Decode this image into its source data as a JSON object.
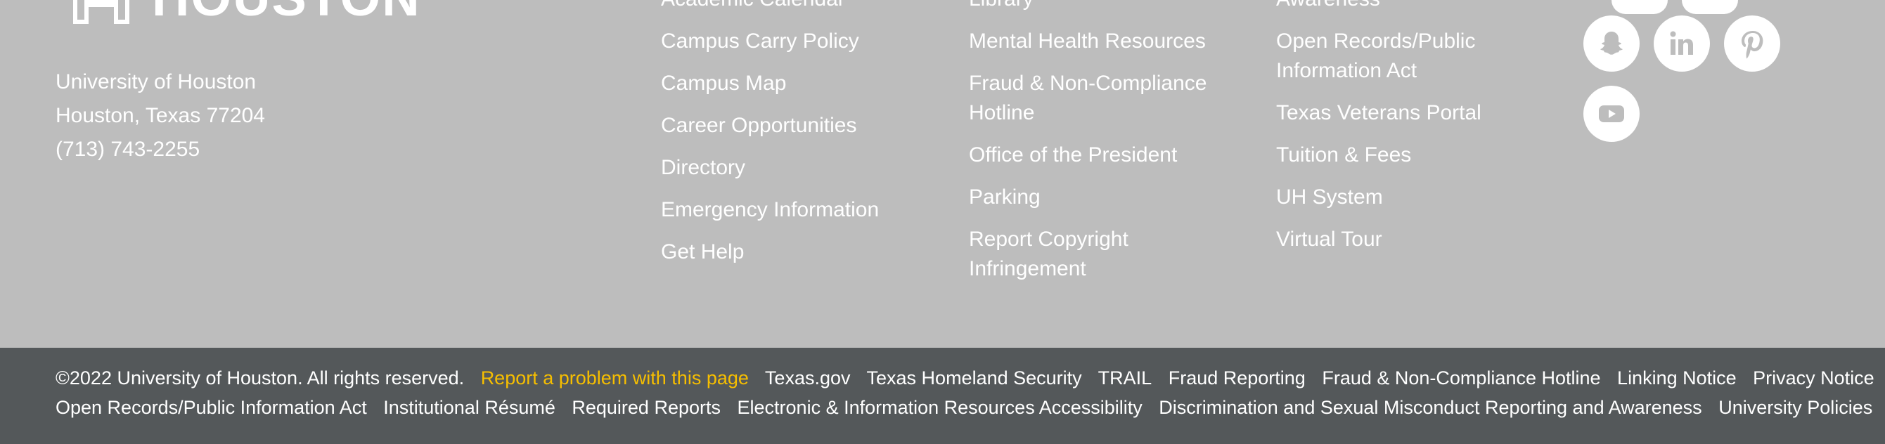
{
  "brand": {
    "wordmark": "HOUSTON"
  },
  "address": {
    "line1": "University of Houston",
    "line2": "Houston, Texas 77204",
    "phone": "(713) 743-2255"
  },
  "links": {
    "col1": [
      "Academic Calendar",
      "Campus Carry Policy",
      "Campus Map",
      "Career Opportunities",
      "Directory",
      "Emergency Information",
      "Get Help"
    ],
    "col2": [
      "Library",
      "Mental Health Resources",
      "Fraud & Non-Compliance Hotline",
      "Office of the President",
      "Parking",
      "Report Copyright Infringement"
    ],
    "col3": [
      "Awareness",
      "Open Records/Public Information Act",
      "Texas Veterans Portal",
      "Tuition & Fees",
      "UH System",
      "Virtual Tour"
    ]
  },
  "social": [
    "snapchat-icon",
    "linkedin-icon",
    "pinterest-icon",
    "youtube-icon"
  ],
  "footer": {
    "copyright": "©2022 University of Houston. All rights reserved.",
    "report": "Report a problem with this page",
    "links1": [
      "Texas.gov",
      "Texas Homeland Security",
      "TRAIL",
      "Fraud Reporting",
      "Fraud & Non-Compliance Hotline",
      "Linking Notice",
      "Privacy Notice"
    ],
    "links2": [
      "Open Records/Public Information Act",
      "Institutional Résumé",
      "Required Reports",
      "Electronic & Information Resources Accessibility",
      "Discrimination and Sexual Misconduct Reporting and Awareness",
      "University Policies"
    ]
  },
  "colors": {
    "footer_bg": "#54585a",
    "upper_bg": "#bdbdbd",
    "accent": "#f6be00"
  }
}
